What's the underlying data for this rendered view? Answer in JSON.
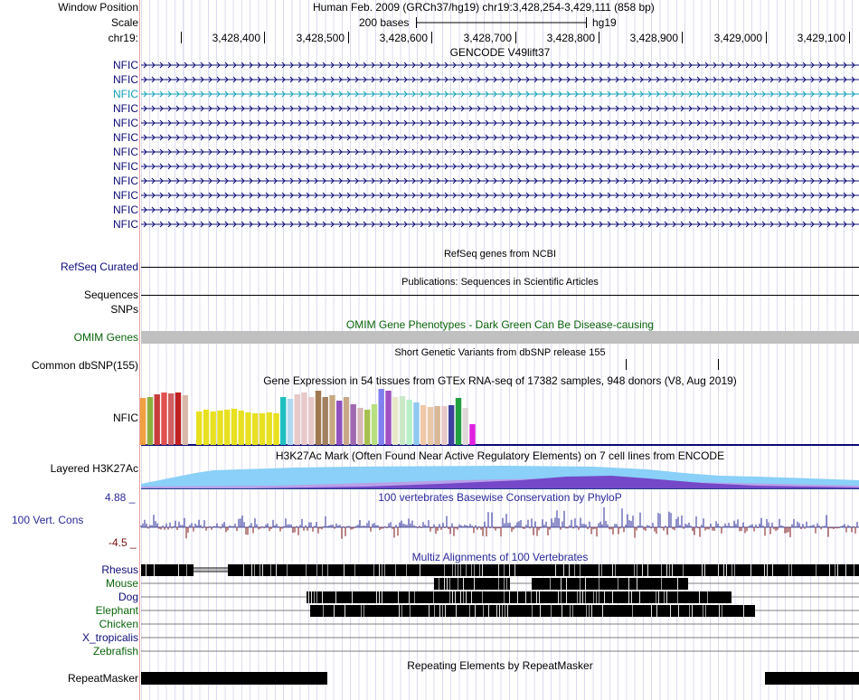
{
  "header": {
    "window_position_label": "Window Position",
    "assembly_text": "Human Feb. 2009 (GRCh37/hg19)   chr19:3,428,254-3,429,111 (858 bp)",
    "scale_label": "Scale",
    "scale_text": "200 bases",
    "scale_db": "hg19",
    "chrom_label": "chr19:",
    "ruler_ticks": [
      "3,428,400",
      "3,428,500",
      "3,428,600",
      "3,428,700",
      "3,428,800",
      "3,428,900",
      "3,429,000",
      "3,429,100"
    ]
  },
  "gencode": {
    "title": "GENCODE V49lift37",
    "transcripts": [
      "NFIC",
      "NFIC",
      "NFIC",
      "NFIC",
      "NFIC",
      "NFIC",
      "NFIC",
      "NFIC",
      "NFIC",
      "NFIC",
      "NFIC",
      "NFIC"
    ],
    "highlight_index": 2,
    "color": "#0c0c78",
    "highlight_color": "#12a0b6"
  },
  "refseq": {
    "center_label": "RefSeq genes from NCBI",
    "track_label": "RefSeq Curated"
  },
  "publications": {
    "center_label": "Publications: Sequences in Scientific Articles",
    "track_label": "Sequences"
  },
  "snps": {
    "track_label": "SNPs"
  },
  "omim": {
    "center_label": "OMIM Gene Phenotypes - Dark Green Can Be Disease-causing",
    "track_label": "OMIM Genes",
    "color": "#0a640a"
  },
  "dbsnp": {
    "center_label": "Short Genetic Variants from dbSNP release 155",
    "track_label": "Common dbSNP(155)"
  },
  "gtex": {
    "center_label": "Gene Expression in 54 tissues from GTEx RNA-seq of 17382 samples, 948 donors (V8, Aug 2019)",
    "track_label": "NFIC",
    "bar_colors": [
      "#f0a040",
      "#8cb040",
      "#c83c3c",
      "#e05050",
      "#d06060",
      "#c02020",
      "#d8b8a8",
      "#ffffff",
      "#e8e020",
      "#e8e020",
      "#e8e020",
      "#e8e020",
      "#e8e020",
      "#e8e020",
      "#e8e020",
      "#e8e020",
      "#e8e020",
      "#e8e020",
      "#e8e020",
      "#e8e020",
      "#20c0c0",
      "#b0d8f0",
      "#e8c8c8",
      "#e8c8c8",
      "#e8c8c8",
      "#a07850",
      "#a08060",
      "#c8a880",
      "#9050c0",
      "#c8a888",
      "#a06ab0",
      "#d8b8b8",
      "#a8c050",
      "#b8e080",
      "#8080f0",
      "#a050c0",
      "#e8e8c8",
      "#c8e8c8",
      "#b8f0c8",
      "#90c8f0",
      "#f0c8a8",
      "#e8c8a8",
      "#d8b898",
      "#e8c8c8",
      "#4040a0",
      "#20a040",
      "#e0d8d8",
      "#e020e0"
    ],
    "bar_values": [
      52,
      53,
      56,
      58,
      57,
      58,
      55,
      0,
      37,
      39,
      37,
      38,
      39,
      40,
      38,
      36,
      35,
      35,
      36,
      35,
      53,
      51,
      56,
      58,
      53,
      60,
      53,
      55,
      49,
      53,
      45,
      41,
      39,
      45,
      62,
      60,
      53,
      54,
      50,
      47,
      44,
      42,
      43,
      43,
      44,
      52,
      41,
      23
    ]
  },
  "h3k27ac": {
    "center_label": "H3K27Ac Mark (Often Found Near Active Regulatory Elements) on 7 cell lines from ENCODE",
    "track_label": "Layered H3K27Ac"
  },
  "phylop": {
    "center_label": "100 vertebrates Basewise Conservation by PhyloP",
    "track_label": "100 Vert. Cons",
    "max_label": "4.88 _",
    "min_label": "-4.5 _",
    "pos_color": "#2a2a9a",
    "neg_color": "#7a1010"
  },
  "multiz": {
    "center_label": "Multiz Alignments of 100 Vertebrates",
    "species": [
      "Rhesus",
      "Mouse",
      "Dog",
      "Elephant",
      "Chicken",
      "X_tropicalis",
      "Zebrafish"
    ],
    "species_colors": [
      "#0c0c78",
      "#0a640a",
      "#0c0c78",
      "#0a640a",
      "#0a640a",
      "#0c0c78",
      "#0a640a"
    ]
  },
  "repeatmasker": {
    "center_label": "Repeating Elements by RepeatMasker",
    "track_label": "RepeatMasker"
  }
}
